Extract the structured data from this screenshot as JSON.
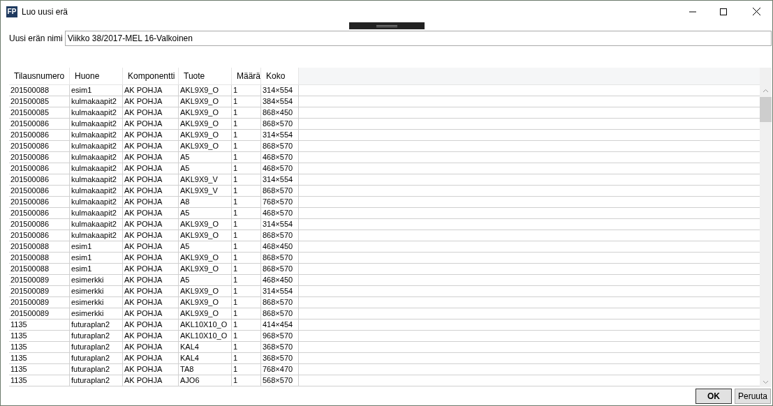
{
  "window": {
    "title": "Luo uusi erä",
    "app_icon": "FP"
  },
  "name_field": {
    "label": "Uusi erän nimi",
    "value": "Viikko 38/2017-MEL 16-Valkoinen"
  },
  "table": {
    "columns": [
      "Tilausnumero",
      "Huone",
      "Komponentti",
      "Tuote",
      "Määrä",
      "Koko"
    ],
    "rows": [
      [
        "201500088",
        "esim1",
        "AK POHJA",
        "AKL9X9_O",
        "1",
        "314×554"
      ],
      [
        "201500085",
        "kulmakaapit2",
        "AK POHJA",
        "AKL9X9_O",
        "1",
        "384×554"
      ],
      [
        "201500085",
        "kulmakaapit2",
        "AK POHJA",
        "AKL9X9_O",
        "1",
        "868×450"
      ],
      [
        "201500086",
        "kulmakaapit2",
        "AK POHJA",
        "AKL9X9_O",
        "1",
        "868×570"
      ],
      [
        "201500086",
        "kulmakaapit2",
        "AK POHJA",
        "AKL9X9_O",
        "1",
        "314×554"
      ],
      [
        "201500086",
        "kulmakaapit2",
        "AK POHJA",
        "AKL9X9_O",
        "1",
        "868×570"
      ],
      [
        "201500086",
        "kulmakaapit2",
        "AK POHJA",
        "A5",
        "1",
        "468×570"
      ],
      [
        "201500086",
        "kulmakaapit2",
        "AK POHJA",
        "A5",
        "1",
        "468×570"
      ],
      [
        "201500086",
        "kulmakaapit2",
        "AK POHJA",
        "AKL9X9_V",
        "1",
        "314×554"
      ],
      [
        "201500086",
        "kulmakaapit2",
        "AK POHJA",
        "AKL9X9_V",
        "1",
        "868×570"
      ],
      [
        "201500086",
        "kulmakaapit2",
        "AK POHJA",
        "A8",
        "1",
        "768×570"
      ],
      [
        "201500086",
        "kulmakaapit2",
        "AK POHJA",
        "A5",
        "1",
        "468×570"
      ],
      [
        "201500086",
        "kulmakaapit2",
        "AK POHJA",
        "AKL9X9_O",
        "1",
        "314×554"
      ],
      [
        "201500086",
        "kulmakaapit2",
        "AK POHJA",
        "AKL9X9_O",
        "1",
        "868×570"
      ],
      [
        "201500088",
        "esim1",
        "AK POHJA",
        "A5",
        "1",
        "468×450"
      ],
      [
        "201500088",
        "esim1",
        "AK POHJA",
        "AKL9X9_O",
        "1",
        "868×570"
      ],
      [
        "201500088",
        "esim1",
        "AK POHJA",
        "AKL9X9_O",
        "1",
        "868×570"
      ],
      [
        "201500089",
        "esimerkki",
        "AK POHJA",
        "A5",
        "1",
        "468×450"
      ],
      [
        "201500089",
        "esimerkki",
        "AK POHJA",
        "AKL9X9_O",
        "1",
        "314×554"
      ],
      [
        "201500089",
        "esimerkki",
        "AK POHJA",
        "AKL9X9_O",
        "1",
        "868×570"
      ],
      [
        "201500089",
        "esimerkki",
        "AK POHJA",
        "AKL9X9_O",
        "1",
        "868×570"
      ],
      [
        "1135",
        "futuraplan2",
        "AK POHJA",
        "AKL10X10_O",
        "1",
        "414×454"
      ],
      [
        "1135",
        "futuraplan2",
        "AK POHJA",
        "AKL10X10_O",
        "1",
        "968×570"
      ],
      [
        "1135",
        "futuraplan2",
        "AK POHJA",
        "KAL4",
        "1",
        "368×570"
      ],
      [
        "1135",
        "futuraplan2",
        "AK POHJA",
        "KAL4",
        "1",
        "368×570"
      ],
      [
        "1135",
        "futuraplan2",
        "AK POHJA",
        "TA8",
        "1",
        "768×470"
      ],
      [
        "1135",
        "futuraplan2",
        "AK POHJA",
        "AJO6",
        "1",
        "568×570"
      ]
    ]
  },
  "buttons": [
    {
      "label": "OK",
      "default": true
    },
    {
      "label": "Peruuta",
      "default": false
    }
  ]
}
